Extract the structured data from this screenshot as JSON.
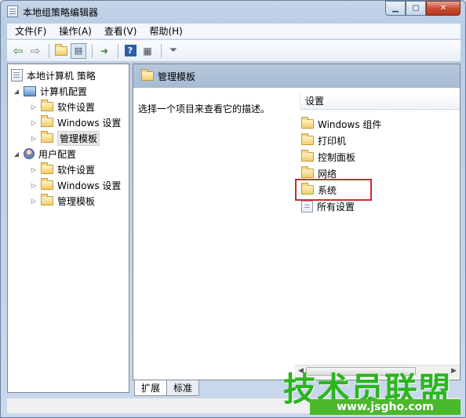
{
  "window": {
    "title": "本地组策略编辑器"
  },
  "menubar": {
    "items": [
      "文件(F)",
      "操作(A)",
      "查看(V)",
      "帮助(H)"
    ]
  },
  "toolbar": {
    "buttons": [
      "back-icon",
      "forward-icon",
      "up-folder-icon",
      "show-hide-tree-icon",
      "export-icon",
      "help-icon",
      "properties-icon",
      "filter-icon"
    ]
  },
  "tree": {
    "root": "本地计算机 策略",
    "computer_config": {
      "label": "计算机配置",
      "children": [
        "软件设置",
        "Windows 设置",
        "管理模板"
      ]
    },
    "user_config": {
      "label": "用户配置",
      "children": [
        "软件设置",
        "Windows 设置",
        "管理模板"
      ]
    }
  },
  "main": {
    "header": "管理模板",
    "description": "选择一个项目来查看它的描述。",
    "column_header": "设置",
    "items": [
      "Windows 组件",
      "打印机",
      "控制面板",
      "网络",
      "系统",
      "所有设置"
    ],
    "highlighted_item": "系统"
  },
  "tabs": [
    "扩展",
    "标准"
  ],
  "watermark": {
    "text": "技术员联盟",
    "url": "www.jsgho.com"
  },
  "colors": {
    "highlight": "#cc2c2c",
    "watermark": "#2cb51f"
  }
}
